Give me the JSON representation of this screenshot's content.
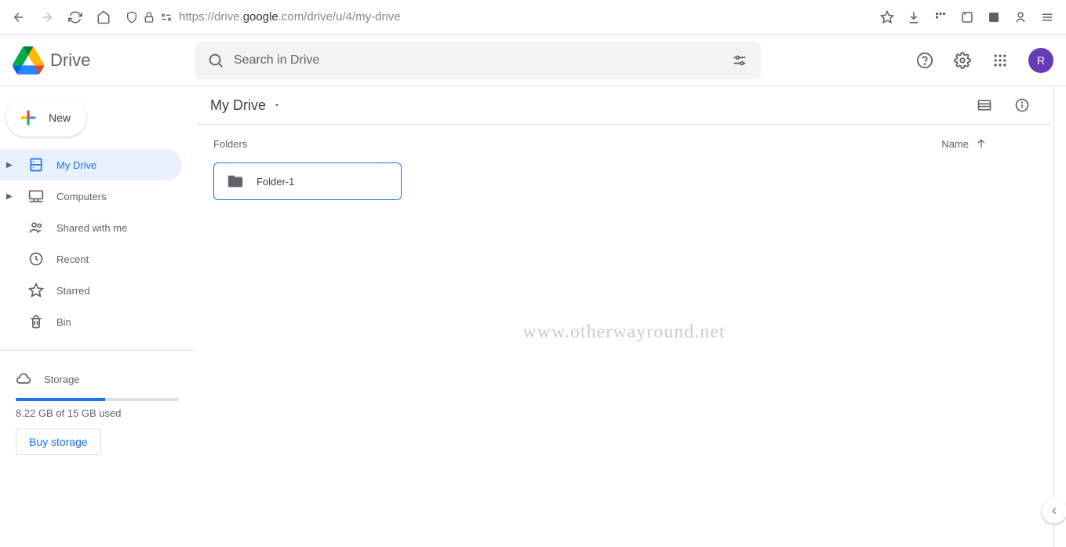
{
  "browser": {
    "url_prefix": "https://drive.",
    "url_domain": "google",
    "url_suffix": ".com/drive/u/4/my-drive"
  },
  "header": {
    "product_name": "Drive",
    "search_placeholder": "Search in Drive",
    "avatar_letter": "R"
  },
  "sidebar": {
    "new_label": "New",
    "items": [
      {
        "label": "My Drive"
      },
      {
        "label": "Computers"
      },
      {
        "label": "Shared with me"
      },
      {
        "label": "Recent"
      },
      {
        "label": "Starred"
      },
      {
        "label": "Bin"
      }
    ],
    "storage_label": "Storage",
    "storage_used": "8.22 GB of 15 GB used",
    "buy_storage": "Buy storage"
  },
  "main": {
    "breadcrumb": "My Drive",
    "folders_label": "Folders",
    "sort_label": "Name",
    "folders": [
      {
        "name": "Folder-1"
      }
    ]
  },
  "watermark": "www.otherwayround.net"
}
